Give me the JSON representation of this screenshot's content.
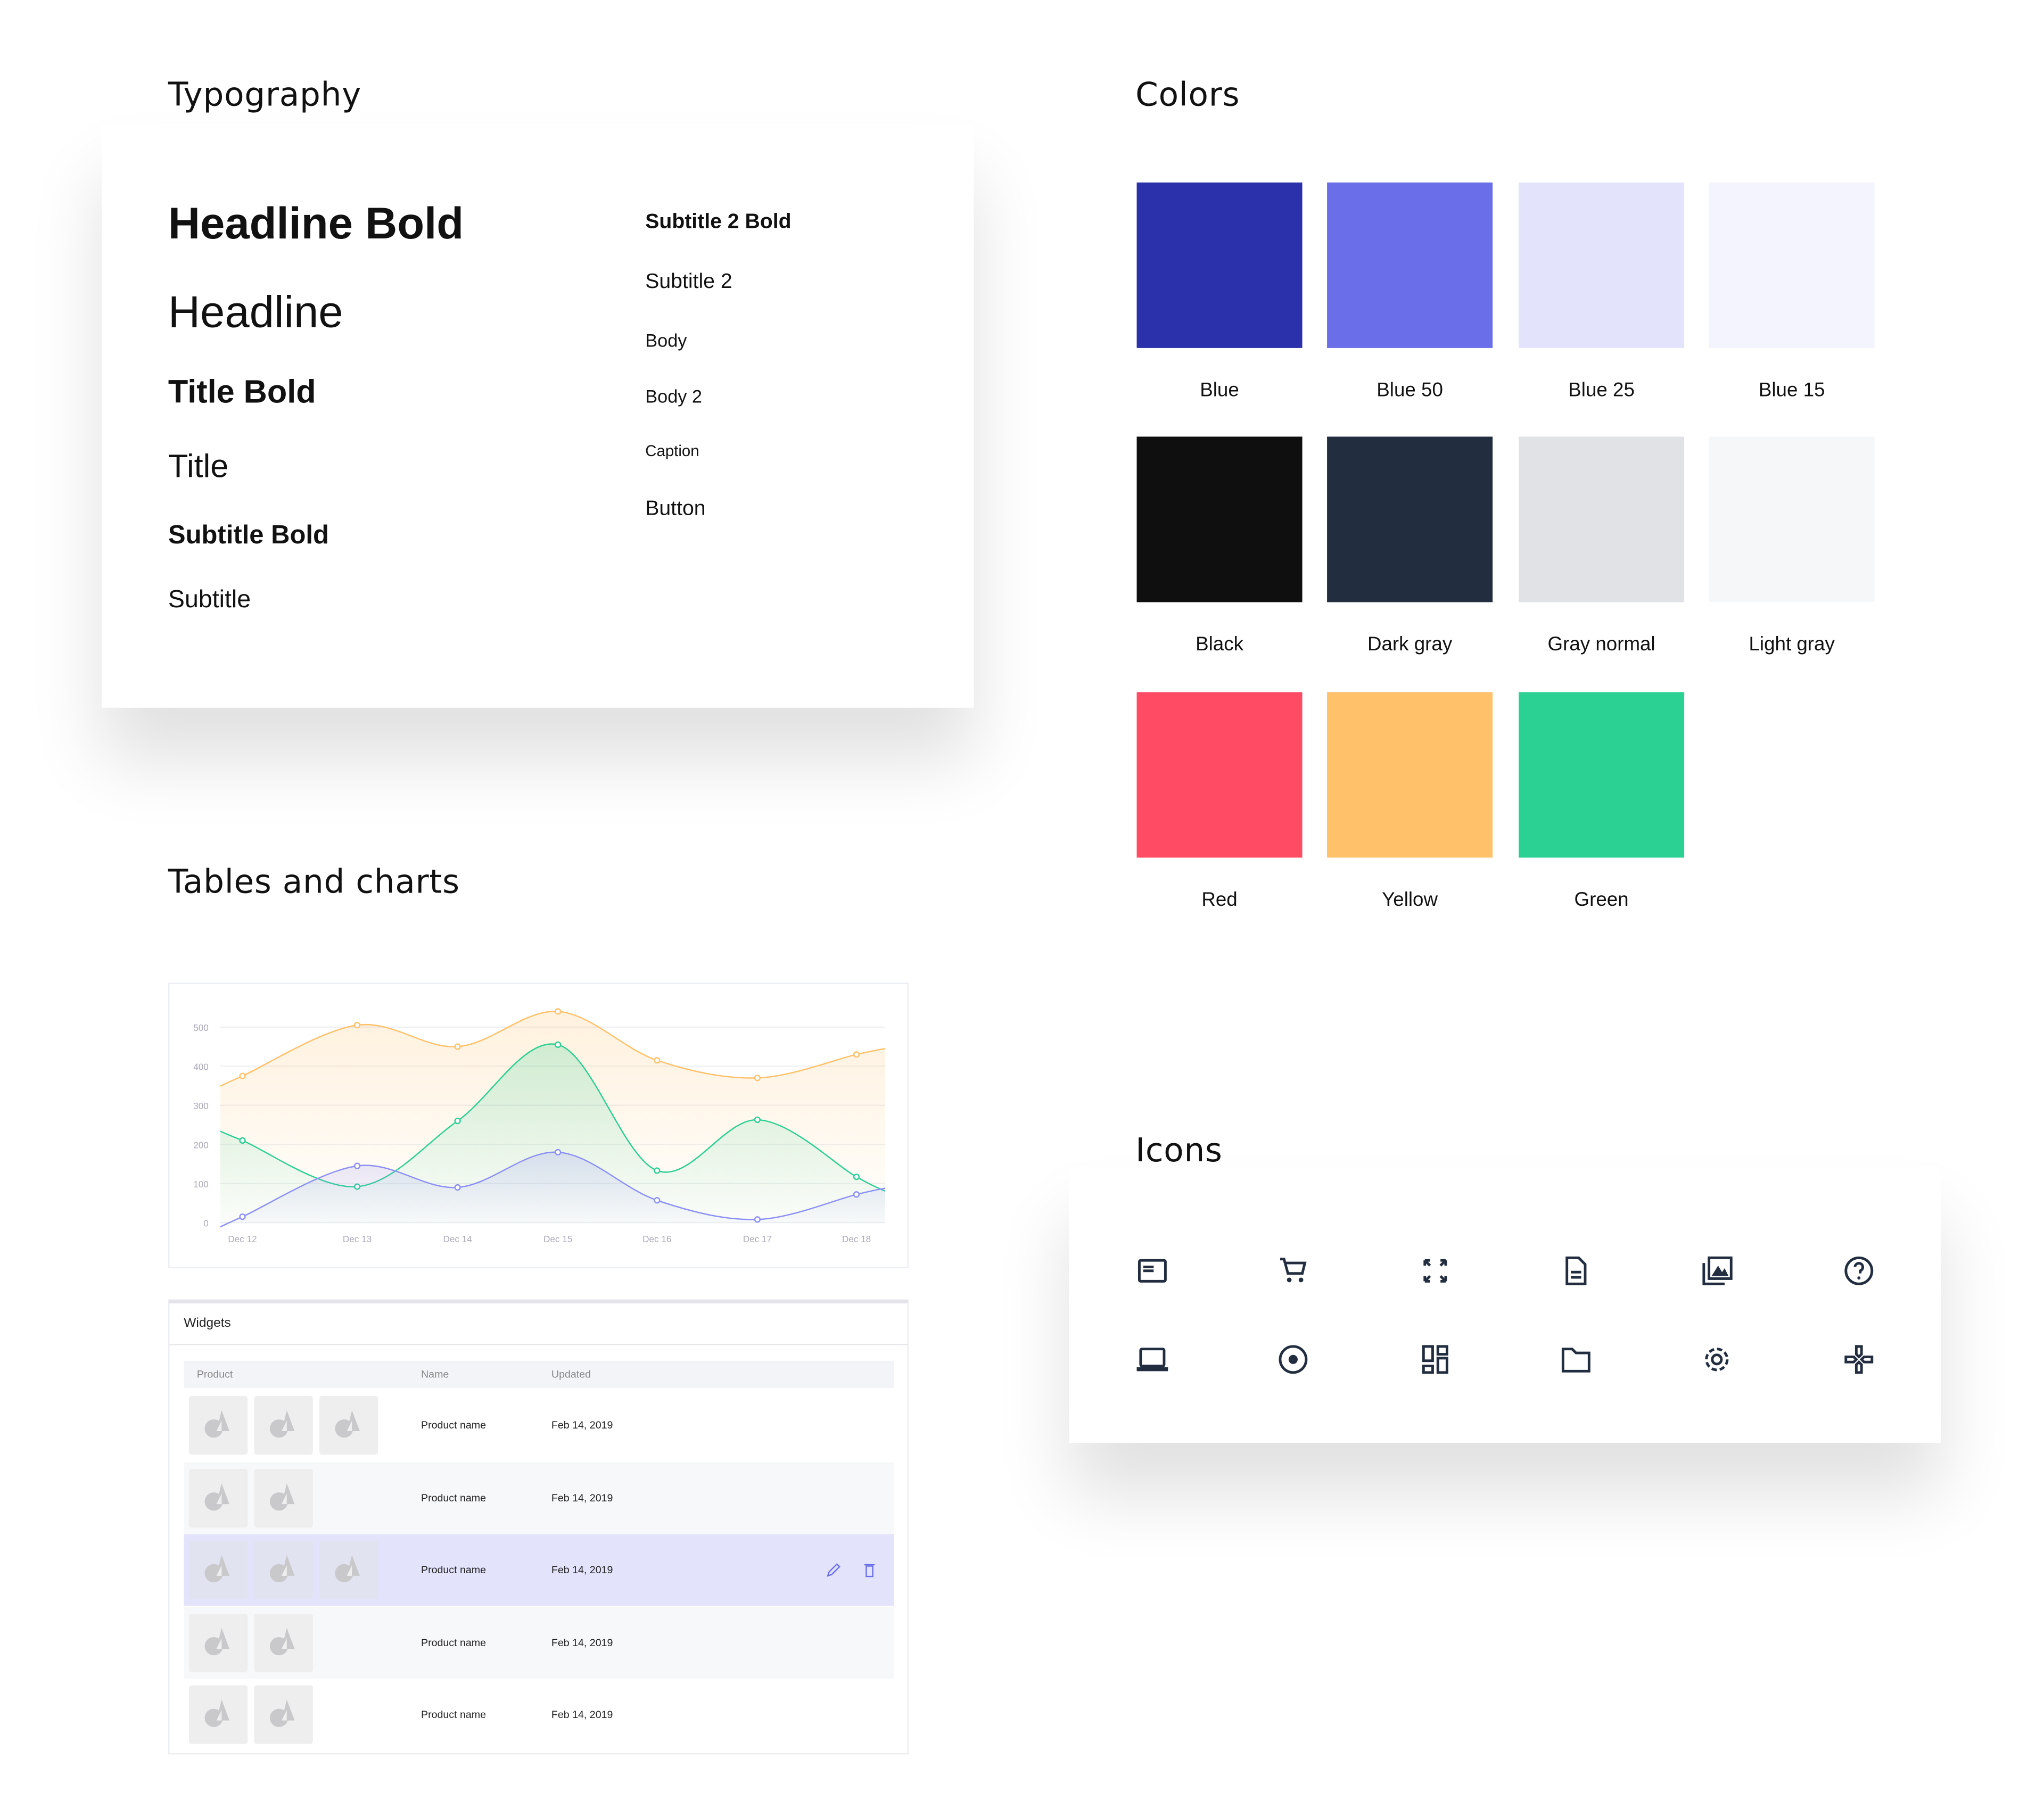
{
  "typography": {
    "title": "Typography",
    "left": [
      "Headline Bold",
      "Headline",
      "Title Bold",
      "Title",
      "Subtitle Bold",
      "Subtitle"
    ],
    "right": [
      "Subtitle 2 Bold",
      "Subtitle 2",
      "Body",
      "Body 2",
      "Caption",
      "Button"
    ]
  },
  "colors": {
    "title": "Colors",
    "swatches": [
      {
        "name": "Blue",
        "hex": "#2B30AB"
      },
      {
        "name": "Blue 50",
        "hex": "#6A6EE8"
      },
      {
        "name": "Blue 25",
        "hex": "#E3E4FC"
      },
      {
        "name": "Blue 15",
        "hex": "#F4F4FE"
      },
      {
        "name": "Black",
        "hex": "#0F0F0F"
      },
      {
        "name": "Dark gray",
        "hex": "#222E40"
      },
      {
        "name": "Gray normal",
        "hex": "#E1E2E6"
      },
      {
        "name": "Light gray",
        "hex": "#F6F7F9"
      },
      {
        "name": "Red",
        "hex": "#FF4B63"
      },
      {
        "name": "Yellow",
        "hex": "#FFC16A"
      },
      {
        "name": "Green",
        "hex": "#2BD093"
      }
    ]
  },
  "tables": {
    "title": "Tables and charts"
  },
  "chart_data": {
    "type": "area",
    "categories": [
      "Dec 12",
      "Dec 13",
      "Dec 14",
      "Dec 15",
      "Dec 16",
      "Dec 17",
      "Dec 18"
    ],
    "yticks": [
      0,
      100,
      200,
      300,
      400,
      500
    ],
    "ylim": [
      0,
      500
    ],
    "grid": true,
    "series": [
      {
        "values": [
          375,
          505,
          450,
          540,
          415,
          370,
          430
        ],
        "color": "#FFC16A"
      },
      {
        "values": [
          210,
          92,
          260,
          455,
          133,
          263,
          117
        ],
        "color": "#2BD093"
      },
      {
        "values": [
          15,
          145,
          90,
          180,
          57,
          8,
          72
        ],
        "color": "#8C8FF5"
      }
    ]
  },
  "widgets": {
    "title": "Widgets",
    "columns": [
      "Product",
      "Name",
      "Updated"
    ],
    "rows": [
      {
        "thumbs": 3,
        "name": "Product name",
        "updated": "Feb 14, 2019"
      },
      {
        "thumbs": 2,
        "name": "Product name",
        "updated": "Feb 14, 2019"
      },
      {
        "thumbs": 3,
        "name": "Product name",
        "updated": "Feb 14, 2019",
        "selected": true
      },
      {
        "thumbs": 2,
        "name": "Product name",
        "updated": "Feb 14, 2019"
      },
      {
        "thumbs": 2,
        "name": "Product name",
        "updated": "Feb 14, 2019"
      }
    ],
    "row_actions": [
      "edit-icon",
      "delete-icon"
    ],
    "selected_color": "#E3E4FC",
    "accent": "#6A6EE8"
  },
  "icons": {
    "title": "Icons",
    "items": [
      "card-icon",
      "cart-icon",
      "fullscreen-icon",
      "document-icon",
      "image-library-icon",
      "help-icon",
      "laptop-icon",
      "radio-icon",
      "dashboard-icon",
      "folder-icon",
      "settings-icon",
      "gamepad-icon"
    ]
  }
}
